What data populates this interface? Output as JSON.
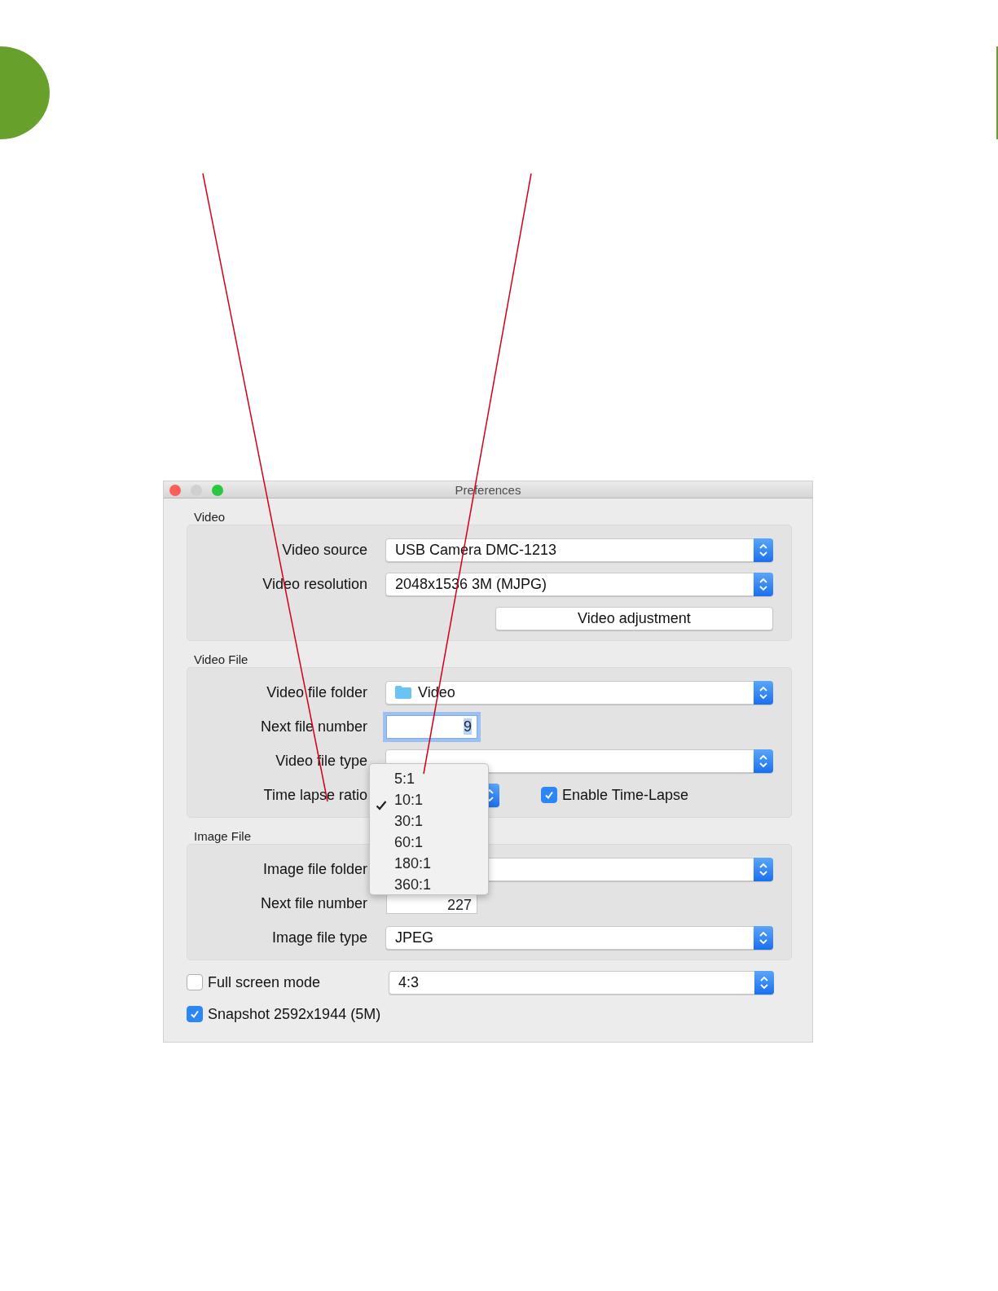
{
  "window": {
    "title": "Preferences"
  },
  "sections": [
    {
      "title": "Video",
      "rows": [
        {
          "kind": "select",
          "label": "Video source",
          "value": "USB Camera DMC-1213"
        },
        {
          "kind": "select",
          "label": "Video resolution",
          "value": "2048x1536 3M (MJPG)"
        },
        {
          "kind": "button",
          "label": "Video adjustment"
        }
      ]
    },
    {
      "title": "Video File",
      "rows": [
        {
          "kind": "folder",
          "label": "Video file folder",
          "value": "Video"
        },
        {
          "kind": "number",
          "label": "Next file number",
          "value": "9",
          "focused": true
        },
        {
          "kind": "select",
          "label": "Video file type"
        },
        {
          "kind": "ratio",
          "label": "Time lapse ratio",
          "checkbox": {
            "label": "Enable Time-Lapse",
            "checked": true
          }
        }
      ]
    },
    {
      "title": "Image File",
      "rows": [
        {
          "kind": "select",
          "label": "Image file folder"
        },
        {
          "kind": "number",
          "label": "Next file number",
          "value": "227",
          "focused": false
        },
        {
          "kind": "select",
          "label": "Image file type",
          "value": "JPEG"
        }
      ]
    }
  ],
  "full_screen": {
    "label": "Full screen mode",
    "checked": false,
    "value": "4:3"
  },
  "snapshot": {
    "label": "Snapshot 2592x1944 (5M)",
    "checked": true
  },
  "menu": {
    "items": [
      {
        "label": "5:1",
        "selected": false
      },
      {
        "label": "10:1",
        "selected": true
      },
      {
        "label": "30:1",
        "selected": false
      },
      {
        "label": "60:1",
        "selected": false
      },
      {
        "label": "180:1",
        "selected": false
      },
      {
        "label": "360:1",
        "selected": false
      }
    ]
  }
}
